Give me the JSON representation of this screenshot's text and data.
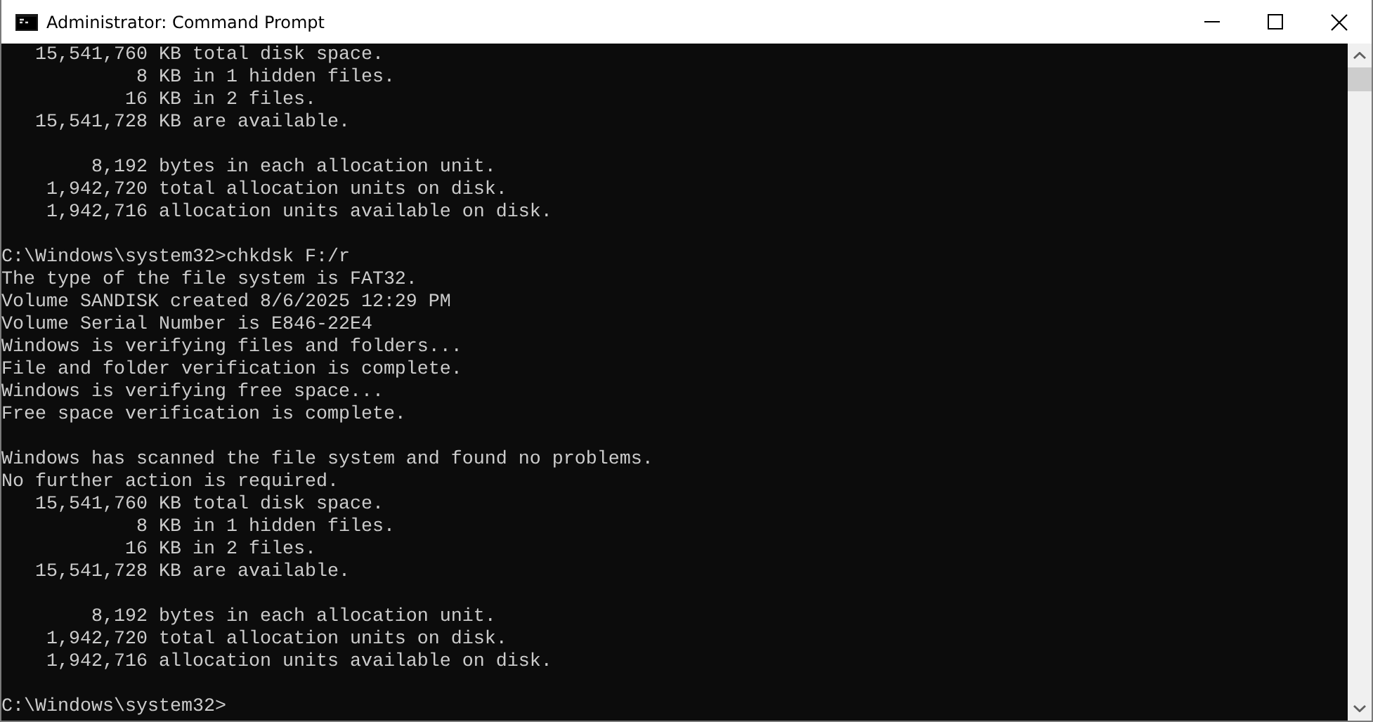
{
  "window": {
    "title": "Administrator: Command Prompt"
  },
  "console": {
    "blocks": [
      [
        "   15,541,760 KB total disk space.",
        "            8 KB in 1 hidden files.",
        "           16 KB in 2 files.",
        "   15,541,728 KB are available."
      ],
      [
        "        8,192 bytes in each allocation unit.",
        "    1,942,720 total allocation units on disk.",
        "    1,942,716 allocation units available on disk."
      ],
      [
        "C:\\Windows\\system32>chkdsk F:/r",
        "The type of the file system is FAT32.",
        "Volume SANDISK created 8/6/2025 12:29 PM",
        "Volume Serial Number is E846-22E4",
        "Windows is verifying files and folders...",
        "File and folder verification is complete.",
        "Windows is verifying free space...",
        "Free space verification is complete."
      ],
      [
        "Windows has scanned the file system and found no problems.",
        "No further action is required.",
        "   15,541,760 KB total disk space.",
        "            8 KB in 1 hidden files.",
        "           16 KB in 2 files.",
        "   15,541,728 KB are available."
      ],
      [
        "        8,192 bytes in each allocation unit.",
        "    1,942,720 total allocation units on disk.",
        "    1,942,716 allocation units available on disk."
      ],
      [
        "C:\\Windows\\system32>"
      ]
    ]
  }
}
